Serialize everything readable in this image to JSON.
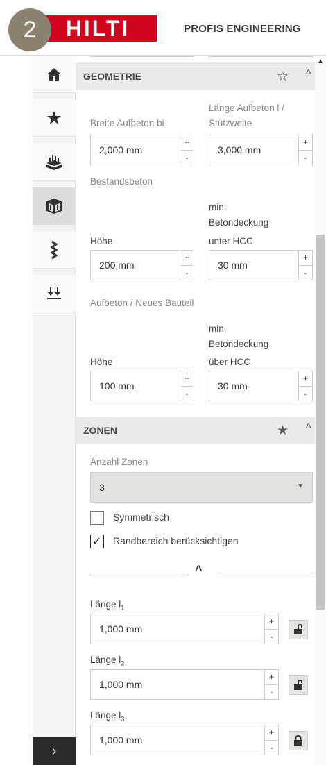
{
  "header": {
    "step_number": "2",
    "logo_text": "HILTI",
    "app_title": "PROFIS ENGINEERING"
  },
  "sidebar": {
    "items": [
      {
        "icon": "home-icon",
        "active": false
      },
      {
        "icon": "star-icon",
        "active": false
      },
      {
        "icon": "anchor-load-icon",
        "active": false
      },
      {
        "icon": "building-block-icon",
        "active": true
      },
      {
        "icon": "rebar-icon",
        "active": false
      },
      {
        "icon": "load-arrows-icon",
        "active": false
      }
    ],
    "expand_label": "›"
  },
  "geometrie": {
    "title": "GEOMETRIE",
    "star": "☆",
    "caret": "^",
    "breite_label": "Breite Aufbeton bi",
    "breite_value": "2,000 mm",
    "laenge_label_1": "Länge Aufbeton l /",
    "laenge_label_2": "Stützweite",
    "laenge_value": "3,000 mm",
    "bestandsbeton_label": "Bestandsbeton",
    "hoehe1_label": "Höhe",
    "hoehe1_value": "200 mm",
    "deckung1_label_1": "min.",
    "deckung1_label_2": "Betondeckung",
    "deckung1_label_3": "unter HCC",
    "deckung1_value": "30 mm",
    "aufbeton_label": "Aufbeton / Neues Bauteil",
    "hoehe2_label": "Höhe",
    "hoehe2_value": "100 mm",
    "deckung2_label_1": "min.",
    "deckung2_label_2": "Betondeckung",
    "deckung2_label_3": "über HCC",
    "deckung2_value": "30 mm",
    "plus": "+",
    "minus": "-"
  },
  "zonen": {
    "title": "ZONEN",
    "star": "★",
    "caret": "^",
    "anzahl_label": "Anzahl Zonen",
    "anzahl_value": "3",
    "dropdown_arrow": "▼",
    "symmetrisch_label": "Symmetrisch",
    "symmetrisch_checked": false,
    "randbereich_label": "Randbereich berücksichtigen",
    "randbereich_checked": true,
    "check_mark": "✓",
    "chevron": "^",
    "zones": [
      {
        "label": "Länge l",
        "sub": "1",
        "value": "1,000 mm",
        "locked": false
      },
      {
        "label": "Länge l",
        "sub": "2",
        "value": "1,000 mm",
        "locked": false
      },
      {
        "label": "Länge l",
        "sub": "3",
        "value": "1,000 mm",
        "locked": true
      }
    ]
  },
  "scrollbar": {
    "up_arrow": "▲"
  }
}
